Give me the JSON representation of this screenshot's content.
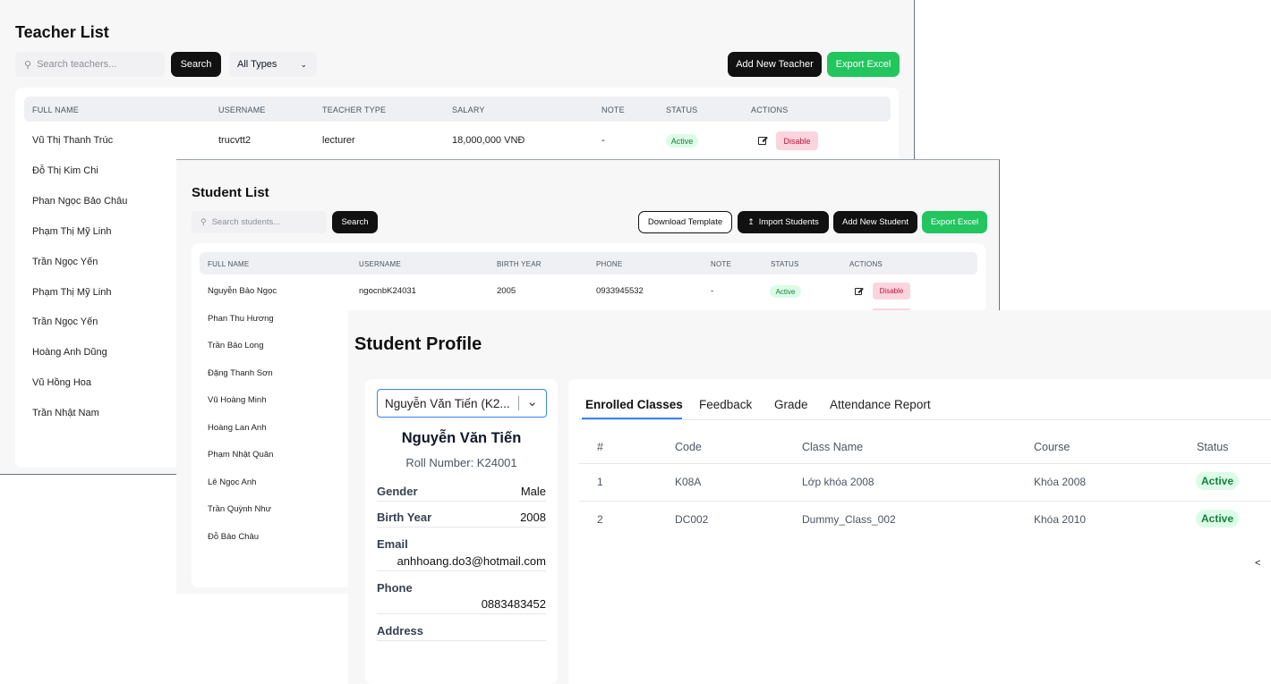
{
  "teacher": {
    "title": "Teacher List",
    "search_placeholder": "Search teachers...",
    "search_button": "Search",
    "type_filter": "All Types",
    "add_button": "Add New Teacher",
    "export_button": "Export Excel",
    "columns": [
      "FULL NAME",
      "USERNAME",
      "TEACHER TYPE",
      "SALARY",
      "NOTE",
      "STATUS",
      "ACTIONS"
    ],
    "first_row": {
      "username": "trucvtt2",
      "type": "lecturer",
      "salary": "18,000,000 VNĐ",
      "note": "-",
      "status": "Active",
      "action": "Disable"
    },
    "names": [
      "Vũ Thị Thanh Trúc",
      "Đỗ Thị Kim Chi",
      "Phan Ngọc Bảo Châu",
      "Phạm Thị Mỹ Linh",
      "Trần Ngọc Yến",
      "Phạm Thị Mỹ Linh",
      "Trần Ngọc Yến",
      "Hoàng Anh Dũng",
      "Vũ Hồng Hoa",
      "Trần Nhật Nam"
    ]
  },
  "student": {
    "title": "Student List",
    "search_placeholder": "Search students...",
    "search_button": "Search",
    "download_button": "Download Template",
    "import_button": "Import Students",
    "add_button": "Add New Student",
    "export_button": "Export Excel",
    "columns": [
      "FULL NAME",
      "USERNAME",
      "BIRTH YEAR",
      "PHONE",
      "NOTE",
      "STATUS",
      "ACTIONS"
    ],
    "first_row": {
      "username": "ngocnbK24031",
      "birth_year": "2005",
      "phone": "0933945532",
      "note": "-",
      "status": "Active",
      "action": "Disable"
    },
    "names": [
      "Nguyễn Bảo Ngọc",
      "Phan Thu Hương",
      "Trần Bảo Long",
      "Đặng Thanh Sơn",
      "Vũ Hoàng Minh",
      "Hoàng Lan Anh",
      "Phạm Nhật Quân",
      "Lê Ngọc Anh",
      "Trần Quỳnh Như",
      "Đỗ Bảo Châu"
    ]
  },
  "profile": {
    "title": "Student Profile",
    "select_value": "Nguyễn Văn Tiến (K2...",
    "name": "Nguyễn Văn Tiến",
    "roll": "Roll Number: K24001",
    "gender_label": "Gender",
    "gender": "Male",
    "birth_label": "Birth Year",
    "birth": "2008",
    "email_label": "Email",
    "email": "anhhoang.do3@hotmail.com",
    "phone_label": "Phone",
    "phone": "0883483452",
    "address_label": "Address",
    "tabs": [
      "Enrolled Classes",
      "Feedback",
      "Grade",
      "Attendance Report"
    ],
    "columns": [
      "#",
      "Code",
      "Class Name",
      "Course",
      "Status"
    ],
    "rows": [
      {
        "num": "1",
        "code": "K08A",
        "name": "Lớp khóa 2008",
        "course": "Khóa 2008",
        "status": "Active"
      },
      {
        "num": "2",
        "code": "DC002",
        "name": "Dummy_Class_002",
        "course": "Khóa 2010",
        "status": "Active"
      }
    ],
    "pager_glyph": "<"
  }
}
